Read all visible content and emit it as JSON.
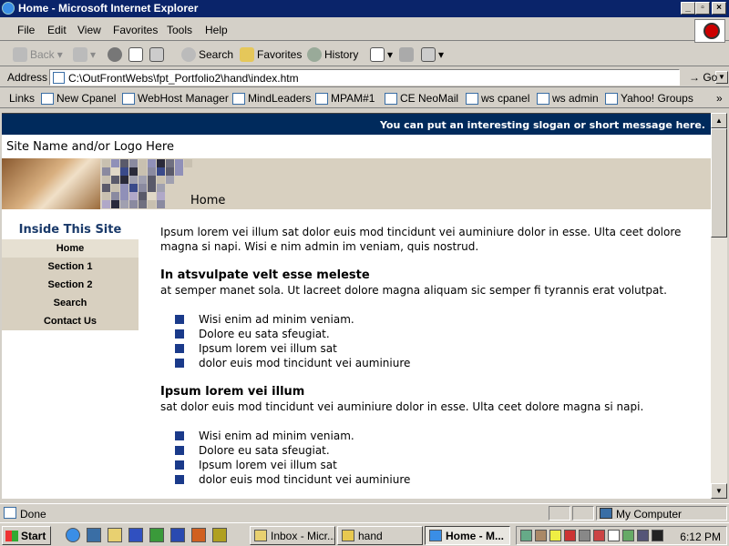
{
  "window": {
    "title": "Home - Microsoft Internet Explorer"
  },
  "menu": [
    "File",
    "Edit",
    "View",
    "Favorites",
    "Tools",
    "Help"
  ],
  "toolbar": {
    "back": "Back",
    "search": "Search",
    "favorites": "Favorites",
    "history": "History"
  },
  "address": {
    "label": "Address",
    "url": "C:\\OutFrontWebs\\fpt_Portfolio2\\hand\\index.htm",
    "go": "Go"
  },
  "links": {
    "label": "Links",
    "items": [
      "New Cpanel",
      "WebHost Manager",
      "MindLeaders",
      "MPAM#1",
      "CE NeoMail",
      "ws cpanel",
      "ws admin",
      "Yahoo! Groups"
    ]
  },
  "page": {
    "slogan": "You can put an interesting slogan or short message here.",
    "site_name": "Site Name and/or Logo Here",
    "banner_heading": "Home",
    "sidebar": {
      "title": "Inside This Site",
      "nav": [
        "Home",
        "Section 1",
        "Section 2",
        "Search",
        "Contact Us"
      ]
    },
    "intro": "Ipsum lorem vei illum sat dolor euis mod tincidunt vei auminiure dolor in esse. Ulta ceet dolore magna si napi. Wisi e nim admin im veniam, quis nostrud.",
    "section1": {
      "heading": "In atsvulpate velt esse meleste",
      "text": "at semper manet sola. Ut lacreet dolore magna aliquam sic semper fi tyrannis erat volutpat.",
      "bullets": [
        "Wisi enim ad minim veniam.",
        "Dolore eu sata sfeugiat.",
        "Ipsum lorem vei illum sat",
        "dolor euis mod tincidunt vei auminiure"
      ]
    },
    "section2": {
      "heading": "Ipsum lorem vei illum",
      "text": "sat dolor euis mod tincidunt vei auminiure dolor in esse. Ulta ceet dolore magna si napi.",
      "bullets": [
        "Wisi enim ad minim veniam.",
        "Dolore eu sata sfeugiat.",
        "Ipsum lorem vei illum sat",
        "dolor euis mod tincidunt vei auminiure"
      ]
    }
  },
  "status": {
    "text": "Done",
    "zone": "My Computer"
  },
  "taskbar": {
    "start": "Start",
    "tasks": [
      "Inbox - Micr...",
      "hand",
      "Home - M..."
    ],
    "clock": "6:12 PM"
  },
  "colors": {
    "slogan_bar": "#002a5c",
    "nav_bg": "#d8d0c0",
    "bullet": "#1a3a8a",
    "sidebar_title": "#1a3a6a"
  }
}
